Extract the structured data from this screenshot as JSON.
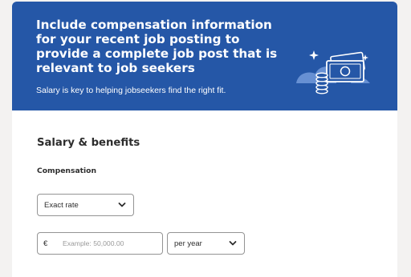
{
  "banner": {
    "title": "Include compensation information for your recent job posting to provide a complete job post that is relevant to job seekers",
    "subtitle": "Salary is key to helping jobseekers find the right fit.",
    "illustration_icon": "money-bills-coins-icon",
    "background_color": "#2557a7"
  },
  "form": {
    "section_title": "Salary & benefits",
    "compensation_label": "Compensation",
    "rate_type": {
      "value": "Exact rate",
      "icon": "chevron-down-icon"
    },
    "salary": {
      "currency": "€",
      "value": "",
      "placeholder": "Example: 50,000.00"
    },
    "period": {
      "value": "per year",
      "icon": "chevron-down-icon"
    }
  }
}
